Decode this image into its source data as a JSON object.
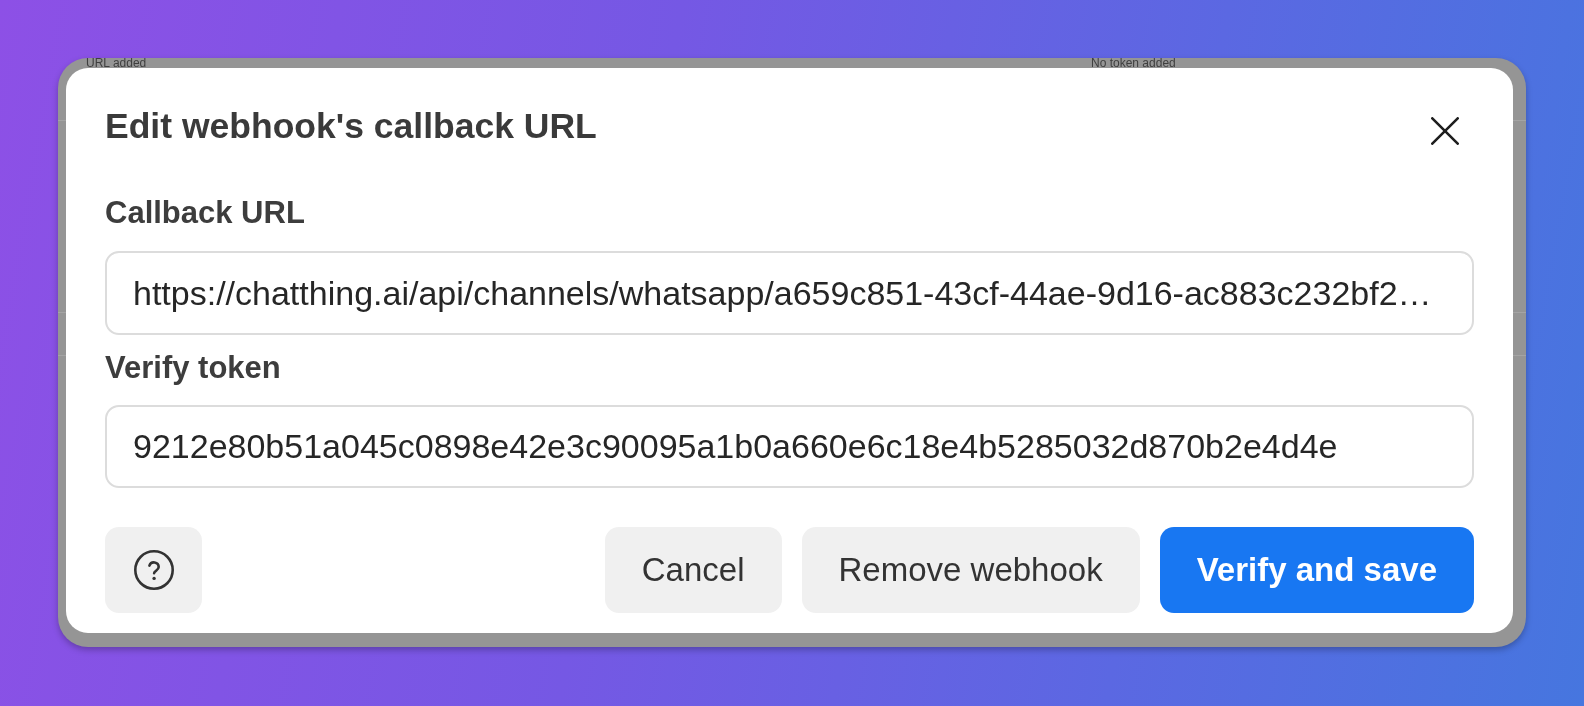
{
  "background_page": {
    "cells": [
      "URL added",
      "No token added"
    ]
  },
  "dialog": {
    "title": "Edit webhook's callback URL",
    "fields": [
      {
        "label": "Callback URL",
        "value": "https://chatthing.ai/api/channels/whatsapp/a659c851-43cf-44ae-9d16-ac883c232bf2…"
      },
      {
        "label": "Verify token",
        "value": "9212e80b51a045c0898e42e3c90095a1b0a660e6c18e4b5285032d870b2e4d4e"
      }
    ],
    "buttons": [
      {
        "label": "Cancel",
        "kind": "secondary"
      },
      {
        "label": "Remove webhook",
        "kind": "secondary"
      },
      {
        "label": "Verify and save",
        "kind": "primary"
      }
    ]
  }
}
